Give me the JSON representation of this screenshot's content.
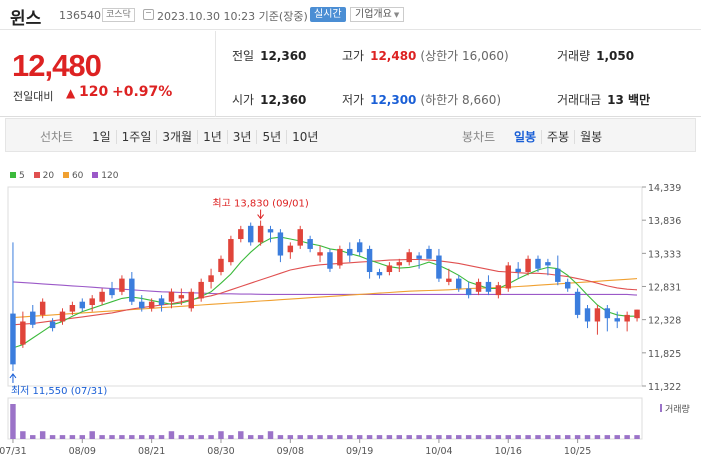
{
  "header": {
    "name": "윈스",
    "code": "136540",
    "market": "코스닥",
    "datetime": "2023.10.30 10:23 기준(장중)",
    "realtime": "실시간",
    "company_info": "기업개요"
  },
  "summary": {
    "price": "12,480",
    "change_label": "전일대비",
    "change_value": "120",
    "change_pct": "+0.97%",
    "prev_close_label": "전일",
    "prev_close": "12,360",
    "high_label": "고가",
    "high": "12,480",
    "upper_limit": "(상한가 16,060)",
    "volume_label": "거래량",
    "volume": "1,050",
    "open_label": "시가",
    "open": "12,360",
    "low_label": "저가",
    "low": "12,300",
    "lower_limit": "(하한가 8,660)",
    "amount_label": "거래대금",
    "amount": "13 백만"
  },
  "tabs": {
    "line_head": "선차트",
    "line_tabs": [
      "1일",
      "1주일",
      "3개월",
      "1년",
      "3년",
      "5년",
      "10년"
    ],
    "candle_head": "봉차트",
    "candle_tabs": [
      "일봉",
      "주봉",
      "월봉"
    ],
    "active_candle": 0
  },
  "chart_data": {
    "type": "candlestick",
    "ma_legend": [
      {
        "name": "5",
        "color": "#3cba3c"
      },
      {
        "name": "20",
        "color": "#e05050"
      },
      {
        "name": "60",
        "color": "#f0a030"
      },
      {
        "name": "120",
        "color": "#9b59c8"
      }
    ],
    "y_ticks": [
      14339,
      13836,
      13333,
      12831,
      12328,
      11825,
      11322
    ],
    "y_tick_labels": [
      "14,339",
      "13,836",
      "13,333",
      "12,831",
      "12,328",
      "11,825",
      "11,322"
    ],
    "ylim": [
      11322,
      14339
    ],
    "x_tick_labels": [
      "07/31",
      "08/09",
      "08/21",
      "08/30",
      "09/08",
      "09/19",
      "10/04",
      "10/16",
      "10/25"
    ],
    "x_tick_index": [
      0,
      7,
      14,
      21,
      28,
      35,
      43,
      50,
      57
    ],
    "high_annotation": "최고 13,830 (09/01)",
    "low_annotation": "최저 11,550 (07/31)",
    "volume_label": "거래량",
    "candles": [
      [
        12420,
        13500,
        11550,
        11650
      ],
      [
        11950,
        12450,
        11900,
        12300
      ],
      [
        12450,
        12550,
        12200,
        12250
      ],
      [
        12400,
        12650,
        12350,
        12600
      ],
      [
        12300,
        12350,
        12150,
        12200
      ],
      [
        12300,
        12500,
        12250,
        12450
      ],
      [
        12450,
        12600,
        12400,
        12550
      ],
      [
        12600,
        12650,
        12450,
        12500
      ],
      [
        12550,
        12700,
        12450,
        12650
      ],
      [
        12600,
        12800,
        12550,
        12750
      ],
      [
        12800,
        12900,
        12650,
        12700
      ],
      [
        12750,
        13000,
        12700,
        12950
      ],
      [
        12950,
        13050,
        12550,
        12600
      ],
      [
        12600,
        12700,
        12450,
        12500
      ],
      [
        12500,
        12650,
        12450,
        12600
      ],
      [
        12650,
        12700,
        12450,
        12550
      ],
      [
        12600,
        12800,
        12500,
        12750
      ],
      [
        12650,
        12800,
        12550,
        12700
      ],
      [
        12500,
        12800,
        12450,
        12750
      ],
      [
        12650,
        12950,
        12600,
        12900
      ],
      [
        12900,
        13100,
        12800,
        13000
      ],
      [
        13050,
        13300,
        13000,
        13250
      ],
      [
        13200,
        13600,
        13150,
        13550
      ],
      [
        13550,
        13750,
        13500,
        13700
      ],
      [
        13750,
        13800,
        13450,
        13500
      ],
      [
        13500,
        13830,
        13450,
        13750
      ],
      [
        13700,
        13750,
        13500,
        13650
      ],
      [
        13650,
        13700,
        13200,
        13300
      ],
      [
        13350,
        13500,
        13250,
        13450
      ],
      [
        13450,
        13750,
        13400,
        13700
      ],
      [
        13550,
        13600,
        13350,
        13400
      ],
      [
        13300,
        13450,
        13200,
        13350
      ],
      [
        13350,
        13400,
        13050,
        13100
      ],
      [
        13150,
        13450,
        13100,
        13400
      ],
      [
        13400,
        13500,
        13200,
        13300
      ],
      [
        13500,
        13550,
        13300,
        13350
      ],
      [
        13400,
        13450,
        12950,
        13050
      ],
      [
        13050,
        13100,
        12950,
        13000
      ],
      [
        13050,
        13200,
        13000,
        13150
      ],
      [
        13150,
        13250,
        13050,
        13200
      ],
      [
        13200,
        13400,
        13150,
        13350
      ],
      [
        13300,
        13350,
        13100,
        13250
      ],
      [
        13400,
        13450,
        13350,
        13250
      ],
      [
        13300,
        13400,
        12900,
        12950
      ],
      [
        12900,
        13100,
        12850,
        12950
      ],
      [
        12950,
        13000,
        12750,
        12800
      ],
      [
        12800,
        12900,
        12650,
        12700
      ],
      [
        12750,
        12950,
        12700,
        12900
      ],
      [
        12900,
        13000,
        12700,
        12750
      ],
      [
        12700,
        12900,
        12650,
        12850
      ],
      [
        12800,
        13200,
        12750,
        13150
      ],
      [
        13100,
        13200,
        12950,
        13050
      ],
      [
        13050,
        13300,
        13000,
        13250
      ],
      [
        13250,
        13300,
        13050,
        13100
      ],
      [
        13200,
        13250,
        13000,
        13150
      ],
      [
        13100,
        13300,
        12850,
        12900
      ],
      [
        12900,
        12950,
        12750,
        12800
      ],
      [
        12750,
        12800,
        12350,
        12400
      ],
      [
        12500,
        12550,
        12200,
        12300
      ],
      [
        12300,
        12550,
        12100,
        12500
      ],
      [
        12500,
        12550,
        12150,
        12350
      ],
      [
        12350,
        12450,
        12200,
        12300
      ],
      [
        12300,
        12450,
        12150,
        12400
      ],
      [
        12350,
        12480,
        12300,
        12480
      ]
    ],
    "ma5": [
      11900,
      11950,
      12050,
      12150,
      12250,
      12300,
      12380,
      12450,
      12500,
      12550,
      12600,
      12650,
      12670,
      12650,
      12620,
      12590,
      12560,
      12580,
      12620,
      12680,
      12750,
      12880,
      13020,
      13200,
      13350,
      13480,
      13560,
      13580,
      13550,
      13520,
      13480,
      13450,
      13400,
      13380,
      13330,
      13290,
      13230,
      13180,
      13130,
      13110,
      13120,
      13150,
      13200,
      13150,
      13080,
      13000,
      12900,
      12850,
      12800,
      12800,
      12870,
      12950,
      13020,
      13080,
      13120,
      13100,
      13000,
      12860,
      12700,
      12550,
      12450,
      12400,
      12380,
      12380
    ],
    "ma20": [
      12250,
      12260,
      12270,
      12290,
      12310,
      12330,
      12350,
      12370,
      12390,
      12410,
      12430,
      12460,
      12490,
      12510,
      12530,
      12550,
      12570,
      12600,
      12630,
      12660,
      12690,
      12730,
      12780,
      12830,
      12880,
      12930,
      12980,
      13030,
      13080,
      13110,
      13140,
      13160,
      13170,
      13180,
      13190,
      13200,
      13210,
      13220,
      13230,
      13235,
      13240,
      13240,
      13230,
      13220,
      13200,
      13180,
      13150,
      13120,
      13090,
      13060,
      13050,
      13040,
      13030,
      13030,
      13020,
      13000,
      12980,
      12950,
      12920,
      12880,
      12840,
      12810,
      12790,
      12780
    ],
    "ma60": [
      12360,
      12370,
      12380,
      12390,
      12400,
      12410,
      12420,
      12430,
      12440,
      12450,
      12460,
      12470,
      12480,
      12490,
      12500,
      12510,
      12520,
      12530,
      12540,
      12550,
      12560,
      12570,
      12580,
      12590,
      12600,
      12610,
      12620,
      12630,
      12640,
      12650,
      12660,
      12670,
      12680,
      12690,
      12700,
      12710,
      12720,
      12730,
      12740,
      12750,
      12760,
      12765,
      12770,
      12775,
      12780,
      12790,
      12800,
      12805,
      12810,
      12815,
      12820,
      12830,
      12840,
      12850,
      12860,
      12870,
      12880,
      12890,
      12900,
      12910,
      12920,
      12930,
      12940,
      12950
    ],
    "ma120": [
      12900,
      12890,
      12880,
      12870,
      12860,
      12850,
      12840,
      12830,
      12820,
      12810,
      12800,
      12790,
      12780,
      12770,
      12760,
      12750,
      12745,
      12740,
      12735,
      12730,
      12725,
      12720,
      12720,
      12715,
      12715,
      12712,
      12710,
      12710,
      12710,
      12710,
      12710,
      12710,
      12710,
      12710,
      12710,
      12710,
      12710,
      12710,
      12710,
      12710,
      12710,
      12710,
      12710,
      12710,
      12710,
      12710,
      12710,
      12710,
      12710,
      12710,
      12710,
      12710,
      12710,
      12710,
      12710,
      12710,
      12710,
      12710,
      12710,
      12710,
      12710,
      12710,
      12710,
      12700
    ],
    "volumes": [
      9,
      2,
      1,
      2,
      1,
      1,
      1,
      1,
      2,
      1,
      1,
      1,
      1,
      1,
      1,
      1,
      2,
      1,
      1,
      1,
      1,
      2,
      1,
      2,
      1,
      1,
      2,
      1,
      1,
      1,
      1,
      1,
      1,
      1,
      1,
      1,
      1,
      1,
      1,
      1,
      1,
      1,
      1,
      1,
      1,
      1,
      1,
      1,
      1,
      1,
      1,
      1,
      1,
      1,
      1,
      1,
      1,
      1,
      1,
      1,
      1,
      1,
      1,
      1
    ]
  }
}
